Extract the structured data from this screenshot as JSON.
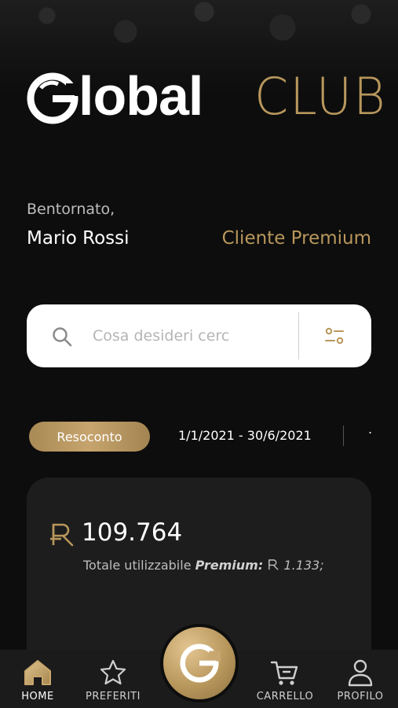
{
  "brand": {
    "logo_main": "lobal",
    "logo_accent": "CLUB"
  },
  "user": {
    "greeting": "Bentornato,",
    "name": "Mario Rossi",
    "tier": "Cliente Premium"
  },
  "search": {
    "placeholder": "Cosa desideri cercare?"
  },
  "tabs": {
    "active_label": "Resoconto",
    "date_range": "1/1/2021 - 30/6/2021",
    "next_label": "."
  },
  "card": {
    "amount": "109.764",
    "sub_label": "Totale utilizzabile",
    "premium_label": "Premium:",
    "premium_value": "1.133;"
  },
  "nav": {
    "home": "HOME",
    "favorites": "PREFERITI",
    "cart": "CARRELLO",
    "profile": "PROFILO"
  },
  "colors": {
    "gold": "#b8975c",
    "background": "#0d0d0d",
    "card": "#1d1d1d"
  }
}
